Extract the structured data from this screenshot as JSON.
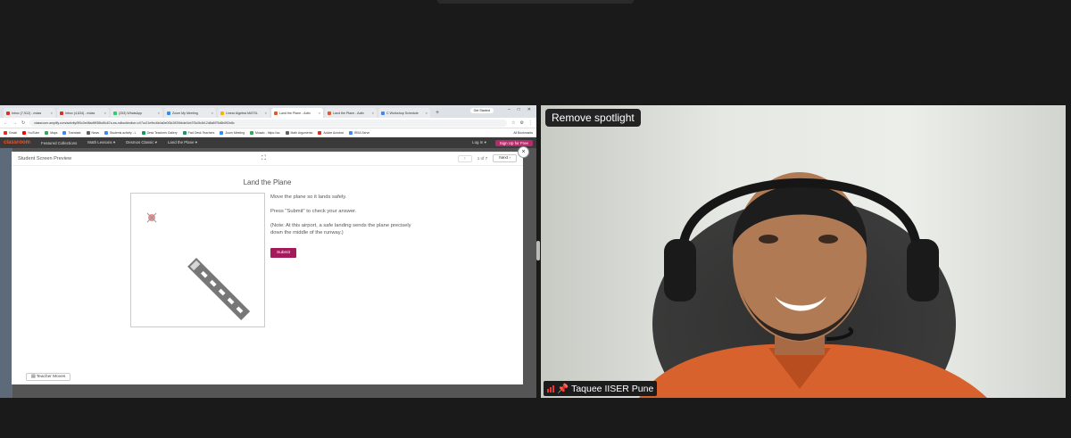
{
  "share": {
    "tabs": [
      {
        "label": "Inbox (7,512) - mdas",
        "color": "#d93025",
        "active": false
      },
      {
        "label": "Inbox (4,634) - mdas",
        "color": "#d93025",
        "active": false
      },
      {
        "label": "(253) WhatsApp",
        "color": "#25d366",
        "active": false
      },
      {
        "label": "Zoom My Meeting",
        "color": "#2d8cff",
        "active": false
      },
      {
        "label": "Linear Algebra MATSL",
        "color": "#f4b400",
        "active": false
      },
      {
        "label": "Land the Plane - Activ",
        "color": "#e8552b",
        "active": true
      },
      {
        "label": "Land the Plane - Activ",
        "color": "#e8552b",
        "active": false
      },
      {
        "label": "C Workshop Schedule",
        "color": "#4285f4",
        "active": false
      }
    ],
    "get_started": "Get Started",
    "url": "classroom.amplify.com/activity/5f0c0e4ffad9ff38bd5c67a-ea-ndbcollection=c07cc21e9ec6b4a0e0f3d1ff20bbde0cb7f3c0b4b12d8a5f75d6b0ff2e8c",
    "bookmarks": [
      {
        "label": "Gmail",
        "color": "#d93025"
      },
      {
        "label": "YouTube",
        "color": "#ff0000"
      },
      {
        "label": "Maps",
        "color": "#34a853"
      },
      {
        "label": "Translate",
        "color": "#4285f4"
      },
      {
        "label": "News",
        "color": "#5f6368"
      },
      {
        "label": "Students activity - L",
        "color": "#4285f4"
      },
      {
        "label": "Desk Teachers Gallery",
        "color": "#0f9d58"
      },
      {
        "label": "Fwd Desk Teachers",
        "color": "#0f9d58"
      },
      {
        "label": "Zoom Meeting",
        "color": "#2d8cff"
      },
      {
        "label": "Mosaic - https://ac",
        "color": "#34a853"
      },
      {
        "label": "Math Argumento",
        "color": "#5f6368"
      },
      {
        "label": "Adobe Acrobat",
        "color": "#d93025"
      },
      {
        "label": "IRSA Serve",
        "color": "#4285f4"
      }
    ],
    "all_bookmarks": "All Bookmarks",
    "app": {
      "brand": "classroom",
      "nav": [
        "Featured Collections",
        "Math Lessons ▾",
        "Desmos Classic ▾",
        "Land the Plane ▾"
      ],
      "login": "Log In ▾",
      "signup": "Sign Up for Free"
    },
    "modal": {
      "header": "Student Screen Preview",
      "page_count": "1 of 7",
      "next": "Next",
      "close": "×",
      "title": "Land the Plane",
      "instructions": [
        "Move the plane so it lands safely.",
        "Press \"Submit\" to check your answer.",
        "(Note: At this airport, a safe landing sends the plane precisely down the middle of the runway.)"
      ],
      "submit": "Submit",
      "teacher_moves": "Teacher Moves"
    }
  },
  "video": {
    "spotlight_button": "Remove spotlight",
    "participant_name": "Taquee IISER Pune"
  },
  "colors": {
    "accent": "#a3195b",
    "brand": "#e8552b",
    "background": "#1a1a1a"
  }
}
